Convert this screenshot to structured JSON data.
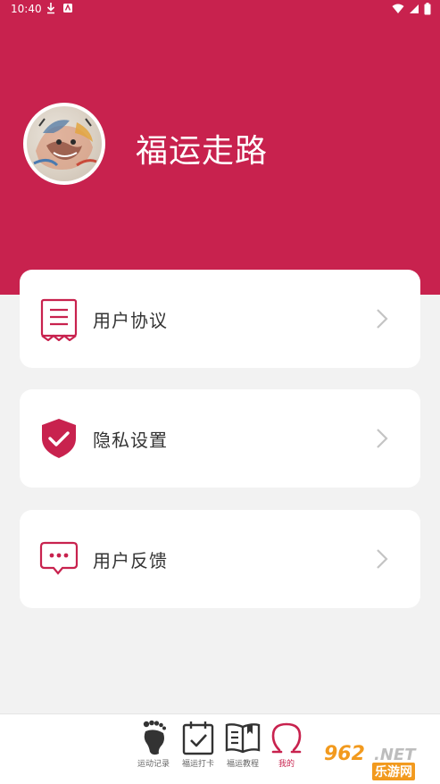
{
  "status_bar": {
    "time": "10:40"
  },
  "profile": {
    "name": "福运走路"
  },
  "menu": [
    {
      "label": "用户协议",
      "icon": "document-icon"
    },
    {
      "label": "隐私设置",
      "icon": "shield-check-icon"
    },
    {
      "label": "用户反馈",
      "icon": "chat-icon"
    }
  ],
  "tabs": [
    {
      "label": "运动记录",
      "icon": "footprint-icon"
    },
    {
      "label": "福运打卡",
      "icon": "calendar-check-icon"
    },
    {
      "label": "福运教程",
      "icon": "book-icon"
    },
    {
      "label": "我的",
      "icon": "profile-icon",
      "active": true
    }
  ],
  "watermark": {
    "number": "962",
    "suffix": ".NET",
    "subtitle": "乐游网"
  },
  "colors": {
    "accent": "#c8224e",
    "background": "#f2f2f2"
  }
}
